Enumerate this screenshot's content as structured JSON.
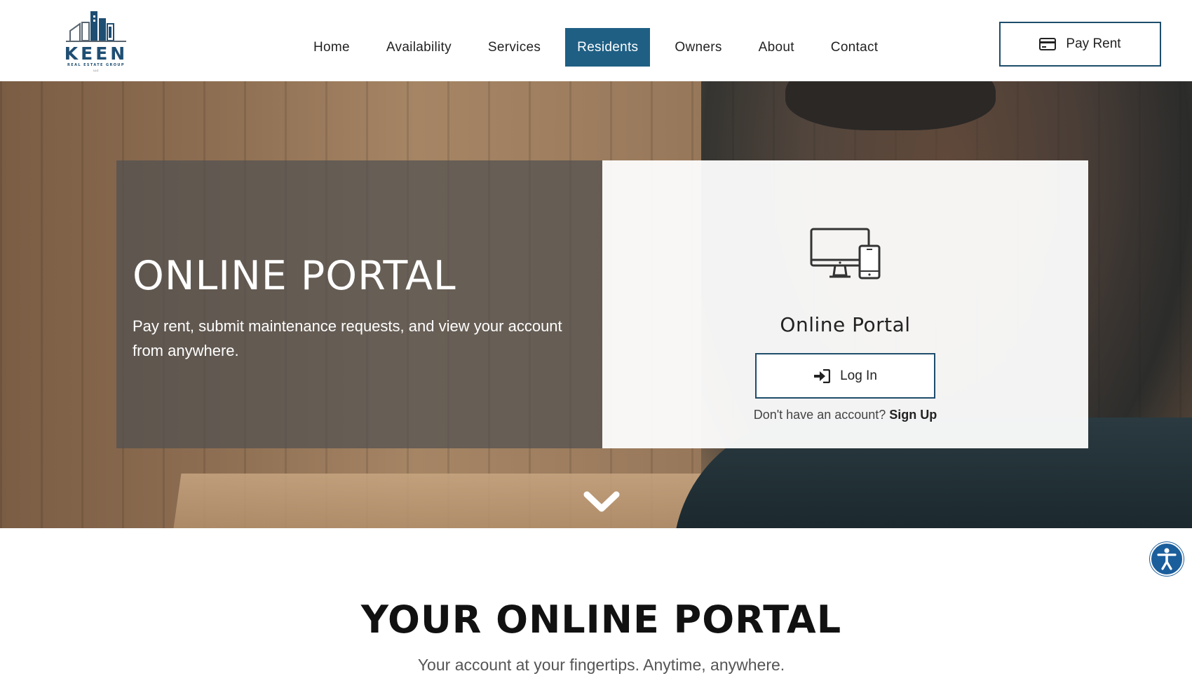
{
  "brand": {
    "wordmark": "KEEN",
    "subtitle": "REAL ESTATE GROUP",
    "suffix": "LLC",
    "color": "#1f4e73"
  },
  "nav": {
    "items": [
      {
        "label": "Home",
        "active": false
      },
      {
        "label": "Availability",
        "active": false
      },
      {
        "label": "Services",
        "active": false
      },
      {
        "label": "Residents",
        "active": true
      },
      {
        "label": "Owners",
        "active": false
      },
      {
        "label": "About",
        "active": false
      },
      {
        "label": "Contact",
        "active": false
      }
    ],
    "active_color": "#1f5f84"
  },
  "header": {
    "pay_rent_label": "Pay Rent",
    "pay_rent_icon": "credit-card-icon"
  },
  "hero": {
    "title": "ONLINE PORTAL",
    "description": "Pay rent, submit maintenance requests, and view your account from anywhere.",
    "card": {
      "icon": "devices-icon",
      "title": "Online Portal",
      "login_label": "Log In",
      "login_icon": "sign-in-icon",
      "signup_prompt": "Don't have an account?",
      "signup_link": "Sign Up"
    },
    "scroll_icon": "chevron-down-icon"
  },
  "accessibility": {
    "icon": "accessibility-icon",
    "color": "#1b5e9c"
  },
  "section": {
    "title": "YOUR ONLINE PORTAL",
    "subtitle": "Your account at your fingertips. Anytime, anywhere."
  }
}
